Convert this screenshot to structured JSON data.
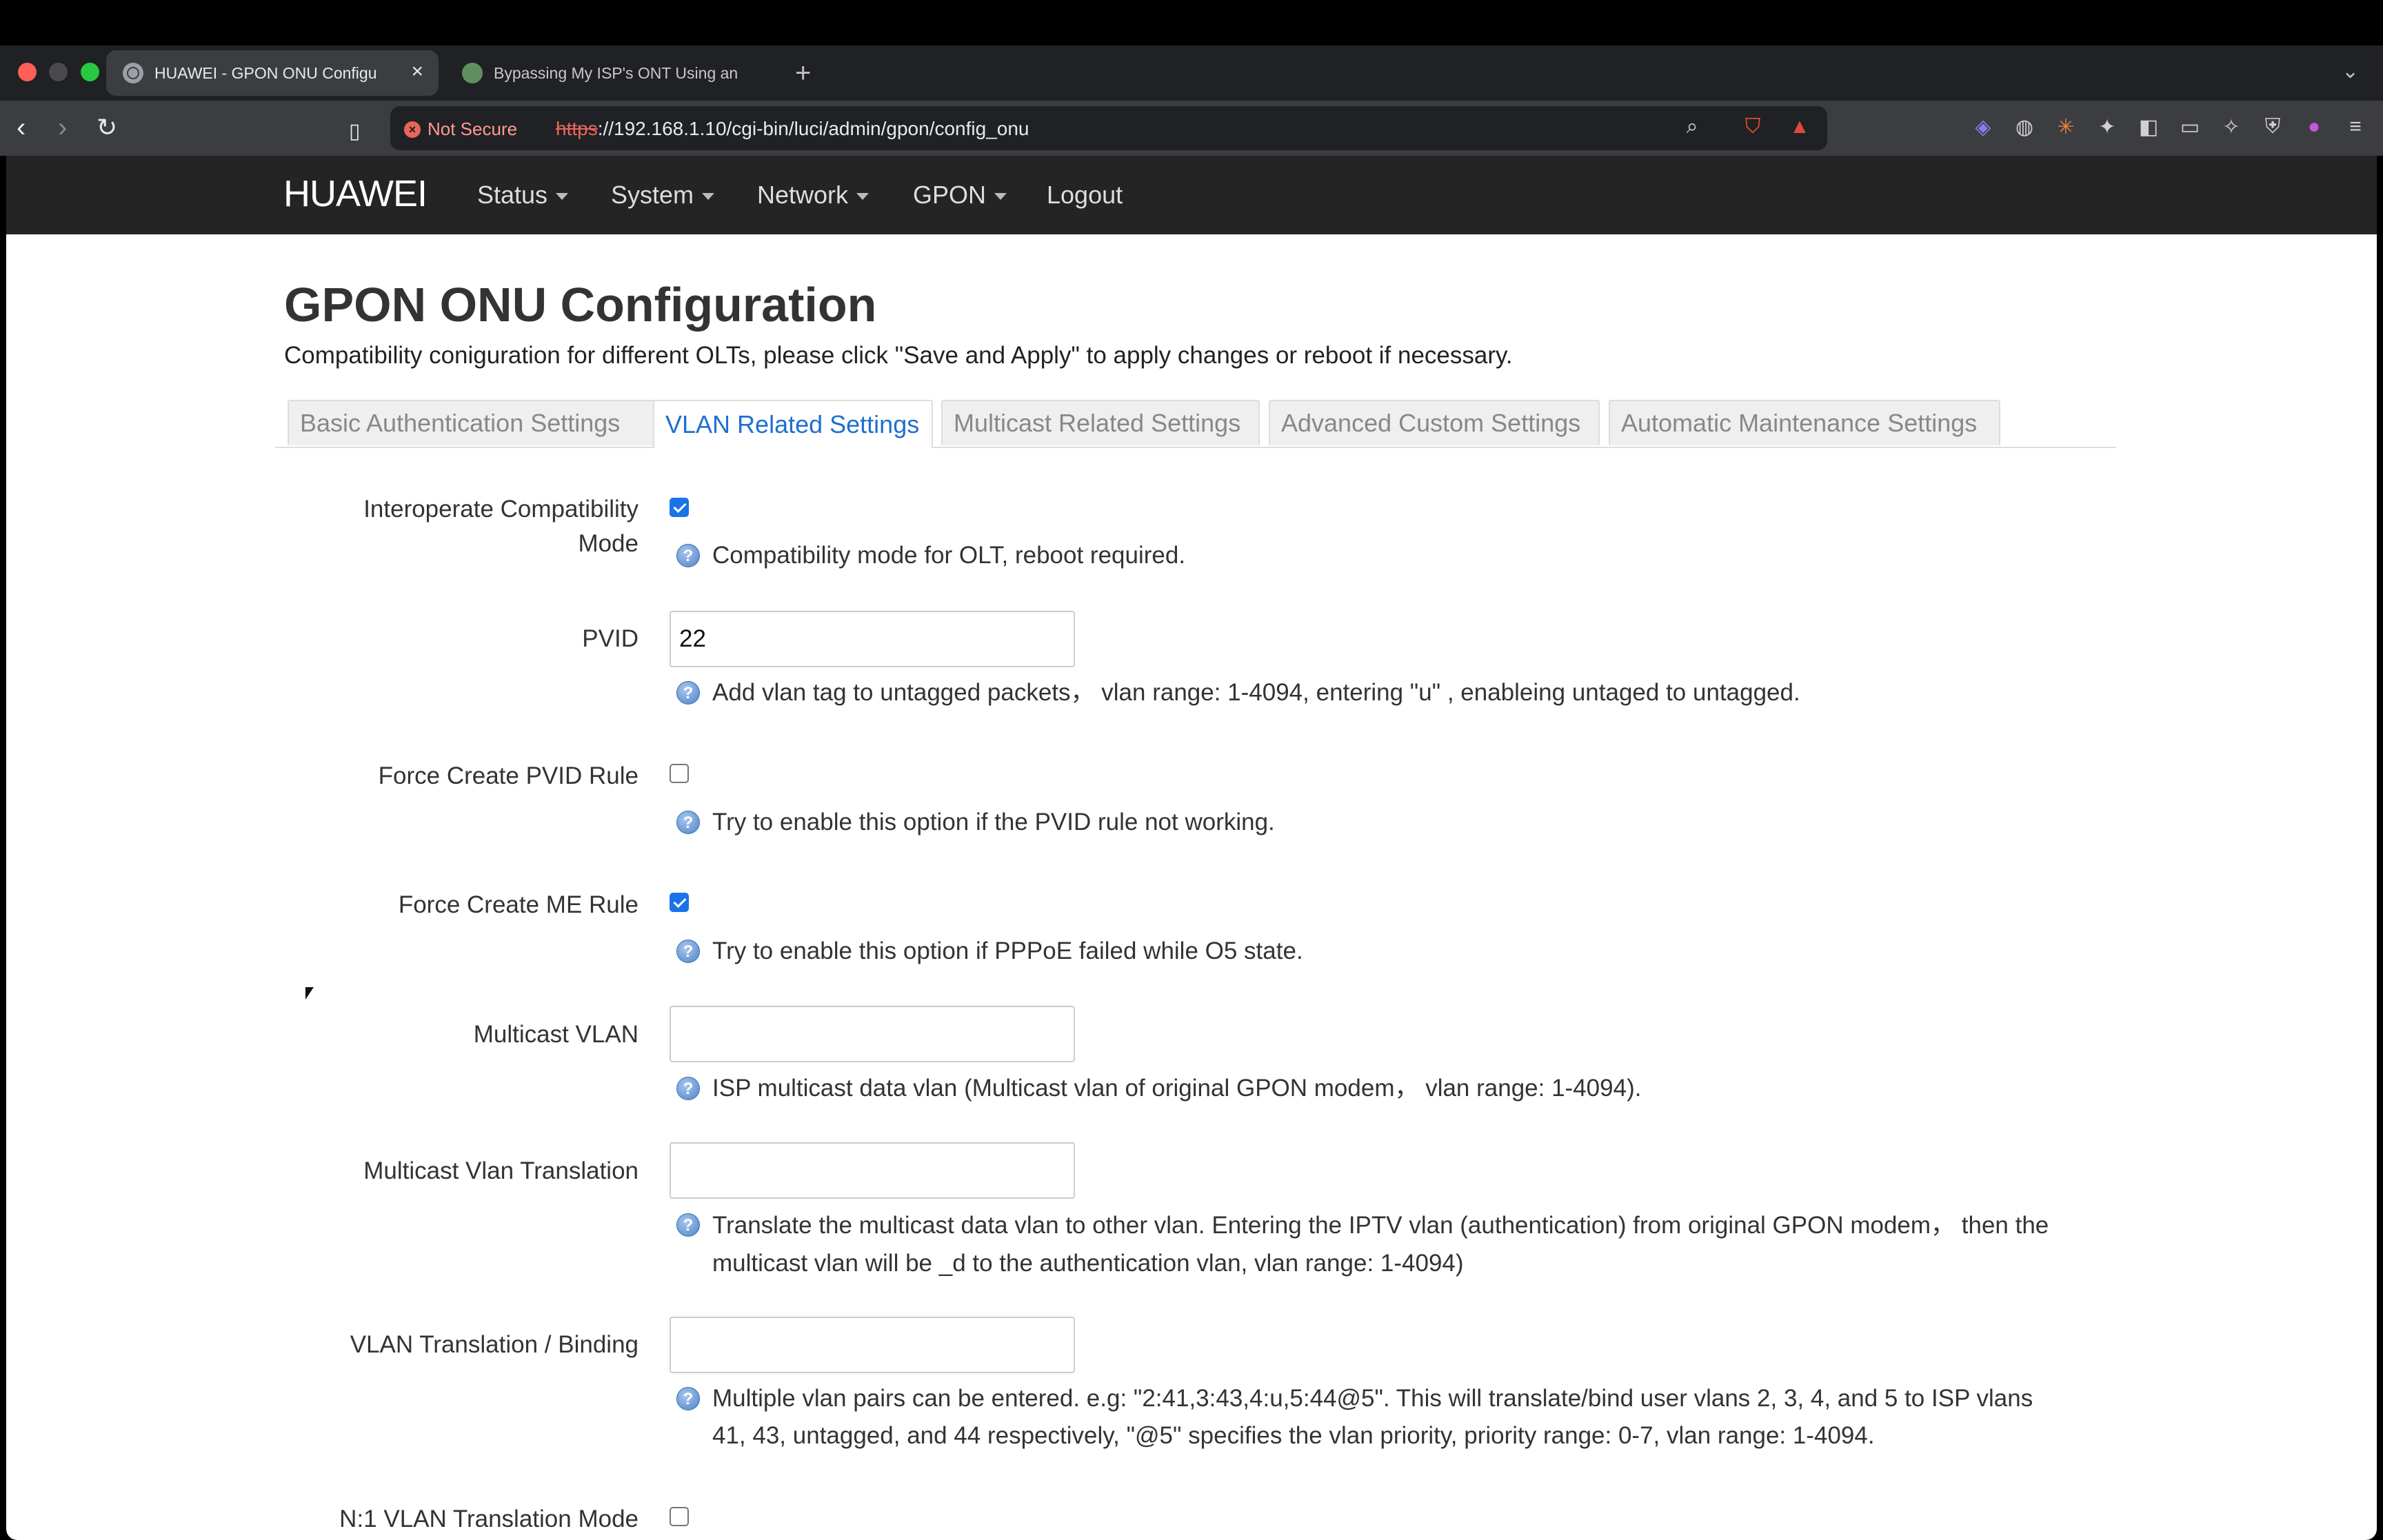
{
  "browser": {
    "tabs": [
      {
        "title": "HUAWEI - GPON ONU Configu",
        "active": true
      },
      {
        "title": "Bypassing My ISP's ONT Using an",
        "active": false
      }
    ],
    "new_tab": "+",
    "security_label": "Not Secure",
    "url_scheme": "https",
    "url_rest": "://192.168.1.10/cgi-bin/luci/admin/gpon/config_onu",
    "colors": {
      "tabbar": "#202124",
      "toolbar": "#3c3d41",
      "insecure": "#e8665a"
    }
  },
  "navbar": {
    "brand": "HUAWEI",
    "menus": [
      "Status",
      "System",
      "Network",
      "GPON"
    ],
    "logout": "Logout"
  },
  "page": {
    "title": "GPON ONU Configuration",
    "description": "Compatibility coniguration for different OLTs, please click \"Save and Apply\" to apply changes or reboot if necessary.",
    "tabs": [
      {
        "label": "Basic Authentication Settings",
        "selected": false
      },
      {
        "label": "VLAN Related Settings",
        "selected": true
      },
      {
        "label": "Multicast Related Settings",
        "selected": false
      },
      {
        "label": "Advanced Custom Settings",
        "selected": false
      },
      {
        "label": "Automatic Maintenance Settings",
        "selected": false
      }
    ],
    "fields": {
      "interop": {
        "label_line1": "Interoperate Compatibility",
        "label_line2": "Mode",
        "checked": true,
        "help": "Compatibility mode for OLT, reboot required."
      },
      "pvid": {
        "label": "PVID",
        "value": "22",
        "help": "Add vlan tag to untagged packets， vlan range: 1-4094, entering \"u\" , enableing untaged to untagged."
      },
      "force_pvid": {
        "label": "Force Create PVID Rule",
        "checked": false,
        "help": "Try to enable this option if the PVID rule not working."
      },
      "force_me": {
        "label": "Force Create ME Rule",
        "checked": true,
        "help": "Try to enable this option if PPPoE failed while O5 state."
      },
      "multicast_vlan": {
        "label": "Multicast VLAN",
        "value": "",
        "help": "ISP multicast data vlan (Multicast vlan of original GPON modem， vlan range: 1-4094)."
      },
      "multicast_translation": {
        "label": "Multicast Vlan Translation",
        "value": "",
        "help_line1": "Translate the multicast data vlan to other vlan. Entering the IPTV vlan (authentication) from original GPON modem， then the",
        "help_line2": "multicast vlan will be _d to the authentication vlan, vlan range: 1-4094)"
      },
      "vlan_binding": {
        "label": "VLAN Translation / Binding",
        "value": "",
        "help_line1": "Multiple vlan pairs can be entered. e.g: \"2:41,3:43,4:u,5:44@5\". This will translate/bind user vlans 2, 3, 4, and 5 to ISP vlans",
        "help_line2": "41, 43, untagged, and 44 respectively, \"@5\" specifies the vlan priority, priority range: 0-7, vlan range: 1-4094."
      },
      "n1_mode": {
        "label": "N:1 VLAN Translation Mode",
        "checked": false
      }
    },
    "help_icon_glyph": "?",
    "colors": {
      "navbar": "#242424",
      "selected_tab": "#1f6fd1",
      "checkbox_checked": "#1a73e8"
    }
  }
}
